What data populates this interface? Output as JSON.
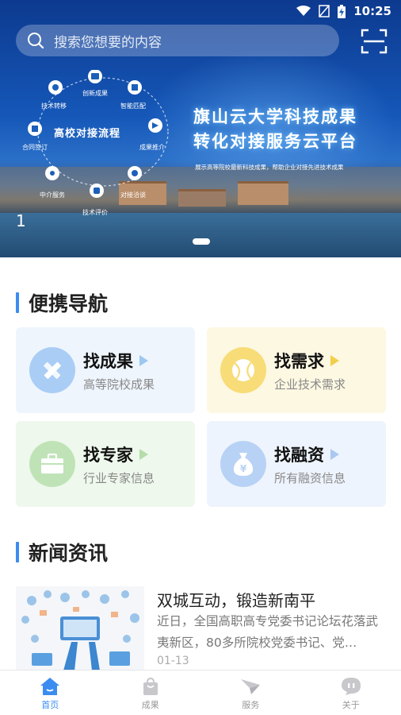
{
  "status": {
    "time": "10:25"
  },
  "search": {
    "placeholder": "搜索您想要的内容"
  },
  "banner": {
    "title_line1": "旗山云大学科技成果",
    "title_line2": "转化对接服务云平台",
    "subtitle": "展示高等院校最新科技成果，帮助企业对接先进技术成果",
    "center_label": "高校对接流程",
    "cycle_nodes": [
      "创新成果",
      "智能匹配",
      "成果推介",
      "对接洽谈",
      "技术评价",
      "中介服务",
      "合同签订",
      "技术转移"
    ],
    "slide_index": "1"
  },
  "nav_section": {
    "title": "便携导航"
  },
  "nav_cards": [
    {
      "title": "找成果",
      "subtitle": "高等院校成果",
      "icon": "ruler-pencil-icon",
      "bg": "#eef5fd",
      "circle": "#a9cdf5",
      "arrow": "#9ec7f2"
    },
    {
      "title": "找需求",
      "subtitle": "企业技术需求",
      "icon": "ball-icon",
      "bg": "#fdf8e2",
      "circle": "#f7dc78",
      "arrow": "#f2cf4a"
    },
    {
      "title": "找专家",
      "subtitle": "行业专家信息",
      "icon": "briefcase-icon",
      "bg": "#eef8ec",
      "circle": "#bfe3b6",
      "arrow": "#b4ddaa"
    },
    {
      "title": "找融资",
      "subtitle": "所有融资信息",
      "icon": "money-bag-icon",
      "bg": "#eef4fd",
      "circle": "#b8d2f5",
      "arrow": "#a9c8f2"
    }
  ],
  "news_section": {
    "title": "新闻资讯"
  },
  "news": [
    {
      "title": "双城互动，锻造新南平",
      "desc": "近日，全国高职高专党委书记论坛花落武夷新区，80多所院校党委书记、党…",
      "date": "01-13"
    }
  ],
  "tabs": [
    {
      "label": "首页",
      "icon": "home-icon",
      "active": true
    },
    {
      "label": "成果",
      "icon": "bag-icon",
      "active": false
    },
    {
      "label": "服务",
      "icon": "paper-plane-icon",
      "active": false
    },
    {
      "label": "关于",
      "icon": "chat-icon",
      "active": false
    }
  ],
  "colors": {
    "accent": "#3b8cf0",
    "inactive": "#c7c7cc"
  }
}
